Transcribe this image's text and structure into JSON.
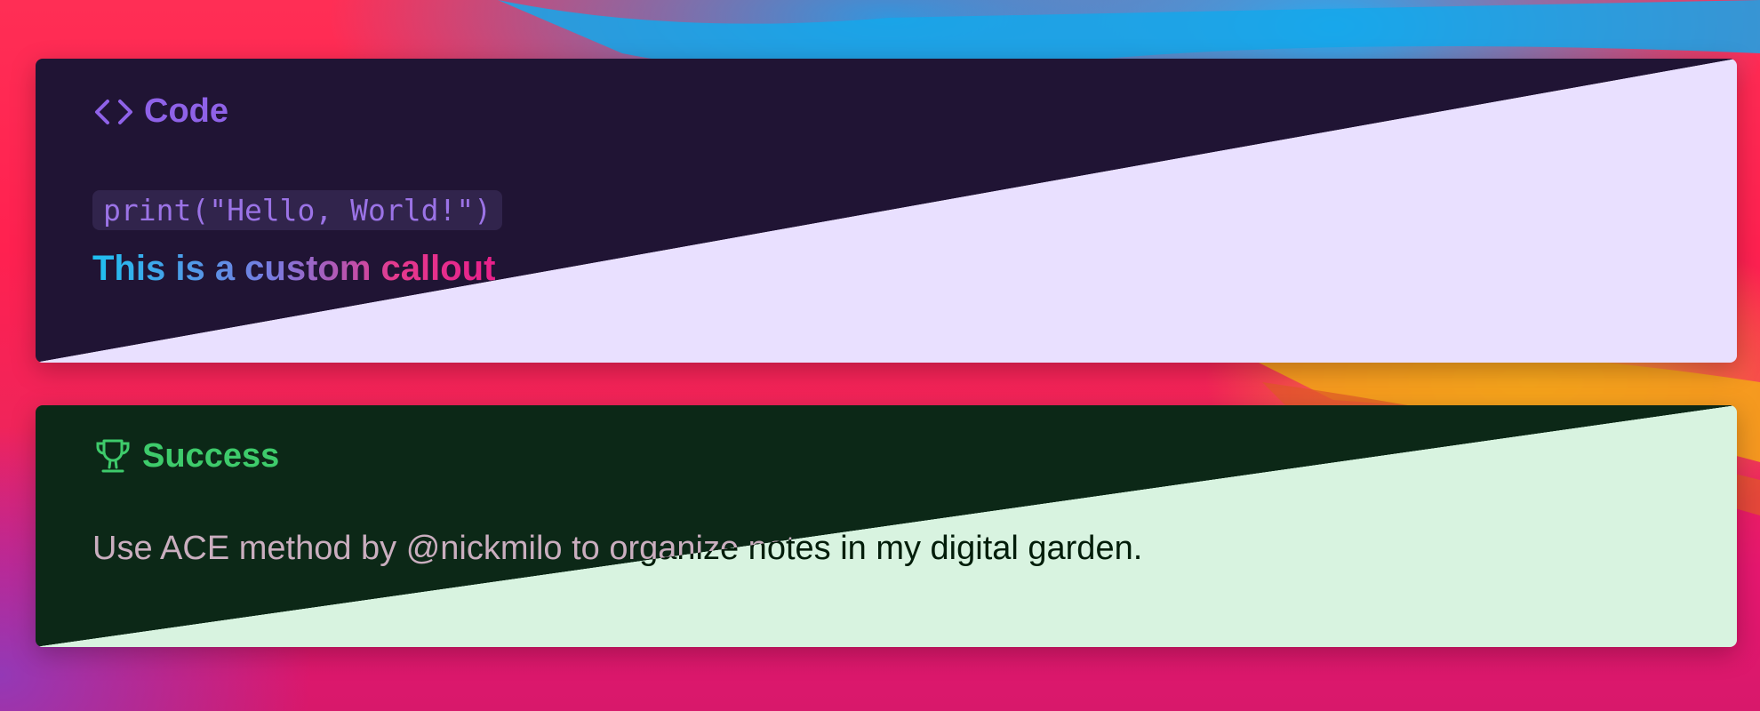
{
  "code_callout": {
    "title": "Code",
    "icon": "code-brackets-icon",
    "snippet": "print(\"Hello, World!\")",
    "text": "This is a custom callout",
    "colors": {
      "dark": "#201434",
      "light": "#e9e0ff",
      "accent": "#8f62e8"
    }
  },
  "success_callout": {
    "title": "Success",
    "icon": "trophy-icon",
    "text": "Use ACE method by @nickmilo to organize notes in my digital garden.",
    "colors": {
      "dark": "#0c2817",
      "light": "#d8f3e0",
      "accent": "#3ecb6b"
    }
  }
}
